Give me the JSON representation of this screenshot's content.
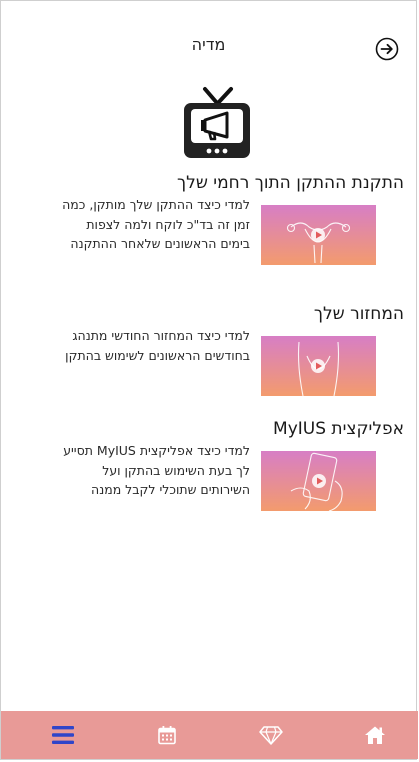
{
  "header": {
    "title": "מדיה",
    "back_icon": "arrow-right-circle-icon"
  },
  "hero": {
    "icon": "tv-megaphone-icon"
  },
  "sections": [
    {
      "title": "התקנת ההתקן התוך רחמי שלך",
      "desc": "למדי כיצד ההתקן שלך מותקן, כמה זמן זה בד\"כ לוקח ולמה לצפות בימים הראשונים שלאחר ההתקנה",
      "thumbnail_icon": "uterus-video-icon"
    },
    {
      "title": "המחזור שלך",
      "desc": "למדי כיצד המחזור החודשי מתנהג בחודשים הראשונים לשימוש בהתקן",
      "thumbnail_icon": "body-video-icon"
    },
    {
      "title": "אפליקצית MyIUS",
      "desc": "למדי כיצד אפליקצית MyIUS תסייע לך בעת השימוש בהתקן ועל השירותים שתוכלי לקבל ממנה",
      "thumbnail_icon": "phone-hand-video-icon"
    }
  ],
  "nav": {
    "items": [
      {
        "icon": "menu-icon",
        "active": true
      },
      {
        "icon": "calendar-icon",
        "active": false
      },
      {
        "icon": "diamond-icon",
        "active": false
      },
      {
        "icon": "home-icon",
        "active": false
      }
    ]
  },
  "colors": {
    "nav_bg": "#e89a97",
    "nav_active": "#2f45c9",
    "nav_icon": "#ffffff",
    "thumb_gradient_top": "#d77ec5",
    "thumb_gradient_bottom": "#f39b6d",
    "play": "#e35c5c"
  }
}
